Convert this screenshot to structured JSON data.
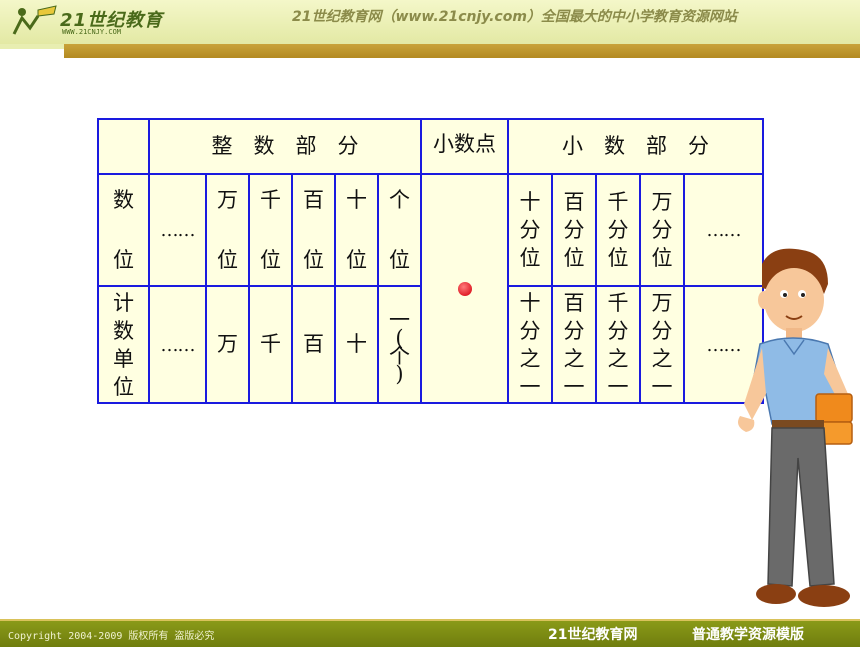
{
  "header": {
    "logo_text": "21世纪教育",
    "logo_sub": "WWW.21CNJY.COM",
    "slogan": "21世纪教育网（www.21cnjy.com）全国最大的中小学教育资源网站"
  },
  "table": {
    "integer_part": "整　数　部　分",
    "decimal_point": "小数点",
    "decimal_part": "小　数　部　分",
    "row1_label": [
      "数",
      "位"
    ],
    "row2_label": [
      "计",
      "数",
      "单",
      "位"
    ],
    "ellipsis": "……",
    "int_places": [
      [
        "万",
        "位"
      ],
      [
        "千",
        "位"
      ],
      [
        "百",
        "位"
      ],
      [
        "十",
        "位"
      ],
      [
        "个",
        "位"
      ]
    ],
    "dec_places": [
      [
        "十",
        "分",
        "位"
      ],
      [
        "百",
        "分",
        "位"
      ],
      [
        "千",
        "分",
        "位"
      ],
      [
        "万",
        "分",
        "位"
      ]
    ],
    "int_units": [
      "万",
      "千",
      "百",
      "十"
    ],
    "ones_unit": [
      "一",
      "(",
      "个",
      ")"
    ],
    "dec_units": [
      [
        "十",
        "分",
        "之",
        "一"
      ],
      [
        "百",
        "分",
        "之",
        "一"
      ],
      [
        "千",
        "分",
        "之",
        "一"
      ],
      [
        "万",
        "分",
        "之",
        "一"
      ]
    ]
  },
  "footer": {
    "copyright": "Copyright 2004-2009 版权所有 盗版必究",
    "brand": "21世纪教育网",
    "tagline": "普通教学资源模版"
  },
  "colors": {
    "table_border": "#1a1adf",
    "table_fill": "#ffffe1",
    "dot": "#e0202a",
    "footer": "#7d8b14"
  },
  "icons": [
    "logo-figure-icon",
    "decimal-point-dot-icon",
    "teacher-illustration"
  ]
}
